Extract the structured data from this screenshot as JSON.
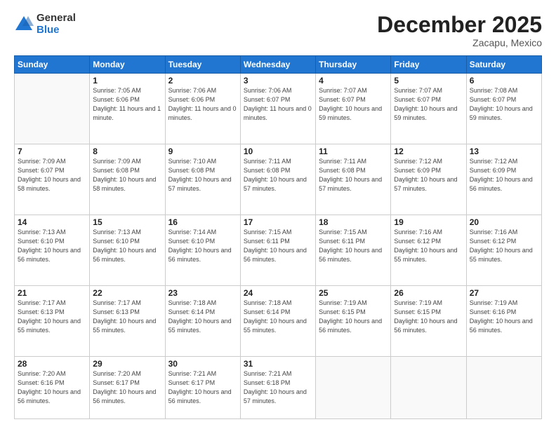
{
  "header": {
    "logo_general": "General",
    "logo_blue": "Blue",
    "month_title": "December 2025",
    "location": "Zacapu, Mexico"
  },
  "days_of_week": [
    "Sunday",
    "Monday",
    "Tuesday",
    "Wednesday",
    "Thursday",
    "Friday",
    "Saturday"
  ],
  "weeks": [
    [
      {
        "day": "",
        "sunrise": "",
        "sunset": "",
        "daylight": "",
        "empty": true
      },
      {
        "day": "1",
        "sunrise": "Sunrise: 7:05 AM",
        "sunset": "Sunset: 6:06 PM",
        "daylight": "Daylight: 11 hours and 1 minute.",
        "empty": false
      },
      {
        "day": "2",
        "sunrise": "Sunrise: 7:06 AM",
        "sunset": "Sunset: 6:06 PM",
        "daylight": "Daylight: 11 hours and 0 minutes.",
        "empty": false
      },
      {
        "day": "3",
        "sunrise": "Sunrise: 7:06 AM",
        "sunset": "Sunset: 6:07 PM",
        "daylight": "Daylight: 11 hours and 0 minutes.",
        "empty": false
      },
      {
        "day": "4",
        "sunrise": "Sunrise: 7:07 AM",
        "sunset": "Sunset: 6:07 PM",
        "daylight": "Daylight: 10 hours and 59 minutes.",
        "empty": false
      },
      {
        "day": "5",
        "sunrise": "Sunrise: 7:07 AM",
        "sunset": "Sunset: 6:07 PM",
        "daylight": "Daylight: 10 hours and 59 minutes.",
        "empty": false
      },
      {
        "day": "6",
        "sunrise": "Sunrise: 7:08 AM",
        "sunset": "Sunset: 6:07 PM",
        "daylight": "Daylight: 10 hours and 59 minutes.",
        "empty": false
      }
    ],
    [
      {
        "day": "7",
        "sunrise": "Sunrise: 7:09 AM",
        "sunset": "Sunset: 6:07 PM",
        "daylight": "Daylight: 10 hours and 58 minutes.",
        "empty": false
      },
      {
        "day": "8",
        "sunrise": "Sunrise: 7:09 AM",
        "sunset": "Sunset: 6:08 PM",
        "daylight": "Daylight: 10 hours and 58 minutes.",
        "empty": false
      },
      {
        "day": "9",
        "sunrise": "Sunrise: 7:10 AM",
        "sunset": "Sunset: 6:08 PM",
        "daylight": "Daylight: 10 hours and 57 minutes.",
        "empty": false
      },
      {
        "day": "10",
        "sunrise": "Sunrise: 7:11 AM",
        "sunset": "Sunset: 6:08 PM",
        "daylight": "Daylight: 10 hours and 57 minutes.",
        "empty": false
      },
      {
        "day": "11",
        "sunrise": "Sunrise: 7:11 AM",
        "sunset": "Sunset: 6:08 PM",
        "daylight": "Daylight: 10 hours and 57 minutes.",
        "empty": false
      },
      {
        "day": "12",
        "sunrise": "Sunrise: 7:12 AM",
        "sunset": "Sunset: 6:09 PM",
        "daylight": "Daylight: 10 hours and 57 minutes.",
        "empty": false
      },
      {
        "day": "13",
        "sunrise": "Sunrise: 7:12 AM",
        "sunset": "Sunset: 6:09 PM",
        "daylight": "Daylight: 10 hours and 56 minutes.",
        "empty": false
      }
    ],
    [
      {
        "day": "14",
        "sunrise": "Sunrise: 7:13 AM",
        "sunset": "Sunset: 6:10 PM",
        "daylight": "Daylight: 10 hours and 56 minutes.",
        "empty": false
      },
      {
        "day": "15",
        "sunrise": "Sunrise: 7:13 AM",
        "sunset": "Sunset: 6:10 PM",
        "daylight": "Daylight: 10 hours and 56 minutes.",
        "empty": false
      },
      {
        "day": "16",
        "sunrise": "Sunrise: 7:14 AM",
        "sunset": "Sunset: 6:10 PM",
        "daylight": "Daylight: 10 hours and 56 minutes.",
        "empty": false
      },
      {
        "day": "17",
        "sunrise": "Sunrise: 7:15 AM",
        "sunset": "Sunset: 6:11 PM",
        "daylight": "Daylight: 10 hours and 56 minutes.",
        "empty": false
      },
      {
        "day": "18",
        "sunrise": "Sunrise: 7:15 AM",
        "sunset": "Sunset: 6:11 PM",
        "daylight": "Daylight: 10 hours and 56 minutes.",
        "empty": false
      },
      {
        "day": "19",
        "sunrise": "Sunrise: 7:16 AM",
        "sunset": "Sunset: 6:12 PM",
        "daylight": "Daylight: 10 hours and 55 minutes.",
        "empty": false
      },
      {
        "day": "20",
        "sunrise": "Sunrise: 7:16 AM",
        "sunset": "Sunset: 6:12 PM",
        "daylight": "Daylight: 10 hours and 55 minutes.",
        "empty": false
      }
    ],
    [
      {
        "day": "21",
        "sunrise": "Sunrise: 7:17 AM",
        "sunset": "Sunset: 6:13 PM",
        "daylight": "Daylight: 10 hours and 55 minutes.",
        "empty": false
      },
      {
        "day": "22",
        "sunrise": "Sunrise: 7:17 AM",
        "sunset": "Sunset: 6:13 PM",
        "daylight": "Daylight: 10 hours and 55 minutes.",
        "empty": false
      },
      {
        "day": "23",
        "sunrise": "Sunrise: 7:18 AM",
        "sunset": "Sunset: 6:14 PM",
        "daylight": "Daylight: 10 hours and 55 minutes.",
        "empty": false
      },
      {
        "day": "24",
        "sunrise": "Sunrise: 7:18 AM",
        "sunset": "Sunset: 6:14 PM",
        "daylight": "Daylight: 10 hours and 55 minutes.",
        "empty": false
      },
      {
        "day": "25",
        "sunrise": "Sunrise: 7:19 AM",
        "sunset": "Sunset: 6:15 PM",
        "daylight": "Daylight: 10 hours and 56 minutes.",
        "empty": false
      },
      {
        "day": "26",
        "sunrise": "Sunrise: 7:19 AM",
        "sunset": "Sunset: 6:15 PM",
        "daylight": "Daylight: 10 hours and 56 minutes.",
        "empty": false
      },
      {
        "day": "27",
        "sunrise": "Sunrise: 7:19 AM",
        "sunset": "Sunset: 6:16 PM",
        "daylight": "Daylight: 10 hours and 56 minutes.",
        "empty": false
      }
    ],
    [
      {
        "day": "28",
        "sunrise": "Sunrise: 7:20 AM",
        "sunset": "Sunset: 6:16 PM",
        "daylight": "Daylight: 10 hours and 56 minutes.",
        "empty": false
      },
      {
        "day": "29",
        "sunrise": "Sunrise: 7:20 AM",
        "sunset": "Sunset: 6:17 PM",
        "daylight": "Daylight: 10 hours and 56 minutes.",
        "empty": false
      },
      {
        "day": "30",
        "sunrise": "Sunrise: 7:21 AM",
        "sunset": "Sunset: 6:17 PM",
        "daylight": "Daylight: 10 hours and 56 minutes.",
        "empty": false
      },
      {
        "day": "31",
        "sunrise": "Sunrise: 7:21 AM",
        "sunset": "Sunset: 6:18 PM",
        "daylight": "Daylight: 10 hours and 57 minutes.",
        "empty": false
      },
      {
        "day": "",
        "sunrise": "",
        "sunset": "",
        "daylight": "",
        "empty": true
      },
      {
        "day": "",
        "sunrise": "",
        "sunset": "",
        "daylight": "",
        "empty": true
      },
      {
        "day": "",
        "sunrise": "",
        "sunset": "",
        "daylight": "",
        "empty": true
      }
    ]
  ]
}
